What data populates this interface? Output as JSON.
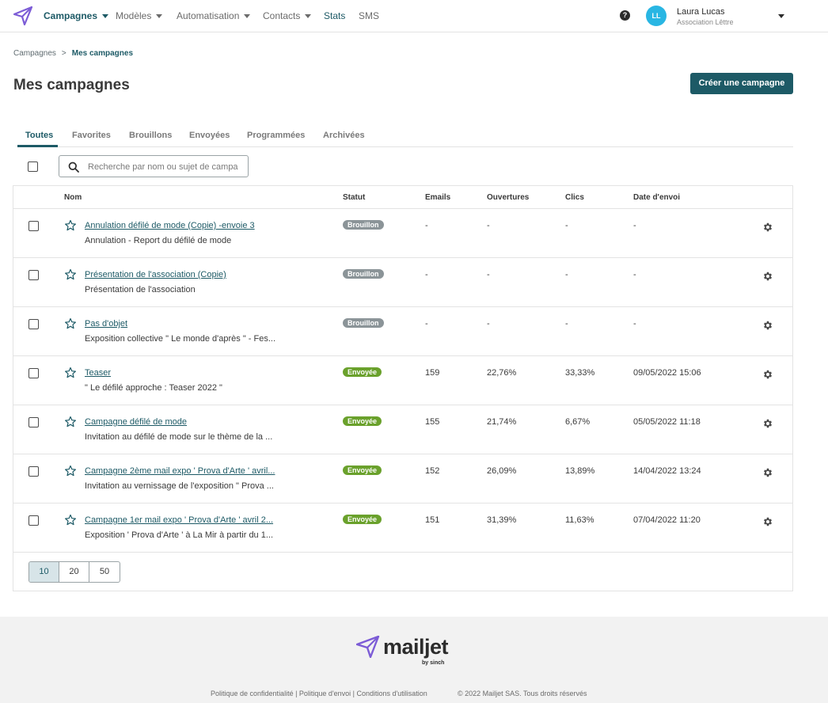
{
  "nav": {
    "items": [
      {
        "label": "Campagnes",
        "has_caret": true
      },
      {
        "label": "Modèles",
        "has_caret": true
      },
      {
        "label": "Automatisation",
        "has_caret": true
      },
      {
        "label": "Contacts",
        "has_caret": true
      },
      {
        "label": "Stats",
        "has_caret": false
      },
      {
        "label": "SMS",
        "has_caret": false
      }
    ],
    "help_label": "?",
    "avatar_initials": "LL",
    "user_name": "Laura Lucas",
    "user_org": "Association Lêttre"
  },
  "breadcrumb": {
    "root": "Campagnes",
    "separator": ">",
    "current": "Mes campagnes"
  },
  "page": {
    "title": "Mes campagnes",
    "create_label": "Créer une campagne"
  },
  "tabs": [
    "Toutes",
    "Favorites",
    "Brouillons",
    "Envoyées",
    "Programmées",
    "Archivées"
  ],
  "search": {
    "placeholder": "Recherche par nom ou sujet de campa"
  },
  "table": {
    "headers": {
      "name": "Nom",
      "status": "Statut",
      "emails": "Emails",
      "opens": "Ouvertures",
      "clicks": "Clics",
      "date": "Date d'envoi"
    },
    "rows": [
      {
        "name": "Annulation défilé de mode (Copie) -envoie 3",
        "subject": "Annulation - Report du défilé de mode",
        "status": "Brouillon",
        "emails": "-",
        "opens": "-",
        "clicks": "-",
        "date": "-"
      },
      {
        "name": "Présentation de l'association (Copie)",
        "subject": "Présentation de l'association",
        "status": "Brouillon",
        "emails": "-",
        "opens": "-",
        "clicks": "-",
        "date": "-"
      },
      {
        "name": "Pas d'objet",
        "subject": "Exposition collective \" Le monde d'après \" - Fes...",
        "status": "Brouillon",
        "emails": "-",
        "opens": "-",
        "clicks": "-",
        "date": "-"
      },
      {
        "name": "Teaser",
        "subject": "\" Le défilé approche : Teaser 2022 \"",
        "status": "Envoyée",
        "emails": "159",
        "opens": "22,76%",
        "clicks": "33,33%",
        "date": "09/05/2022 15:06"
      },
      {
        "name": "Campagne défilé de mode",
        "subject": "Invitation au défilé de mode sur le thème de la ...",
        "status": "Envoyée",
        "emails": "155",
        "opens": "21,74%",
        "clicks": "6,67%",
        "date": "05/05/2022 11:18"
      },
      {
        "name": "Campagne 2ème mail expo ' Prova d'Arte ' avril...",
        "subject": "Invitation au vernissage de l'exposition \" Prova ...",
        "status": "Envoyée",
        "emails": "152",
        "opens": "26,09%",
        "clicks": "13,89%",
        "date": "14/04/2022 13:24"
      },
      {
        "name": "Campagne 1er mail expo ' Prova d'Arte ' avril 2...",
        "subject": "Exposition ' Prova d'Arte ' à La Mir à partir du 1...",
        "status": "Envoyée",
        "emails": "151",
        "opens": "31,39%",
        "clicks": "11,63%",
        "date": "07/04/2022 11:20"
      }
    ]
  },
  "pager": {
    "options": [
      "10",
      "20",
      "50"
    ],
    "selected": "10"
  },
  "footer": {
    "brand": "mailjet",
    "by": "by sinch",
    "links": "Politique de confidentialité | Politique d'envoi | Conditions d'utilisation",
    "copyright": "© 2022 Mailjet SAS. Tous droits réservés"
  },
  "colors": {
    "primary": "#1d5a66",
    "draft_badge": "#8b9498",
    "sent_badge": "#6aa12c",
    "logo": "#7c5cd6"
  }
}
